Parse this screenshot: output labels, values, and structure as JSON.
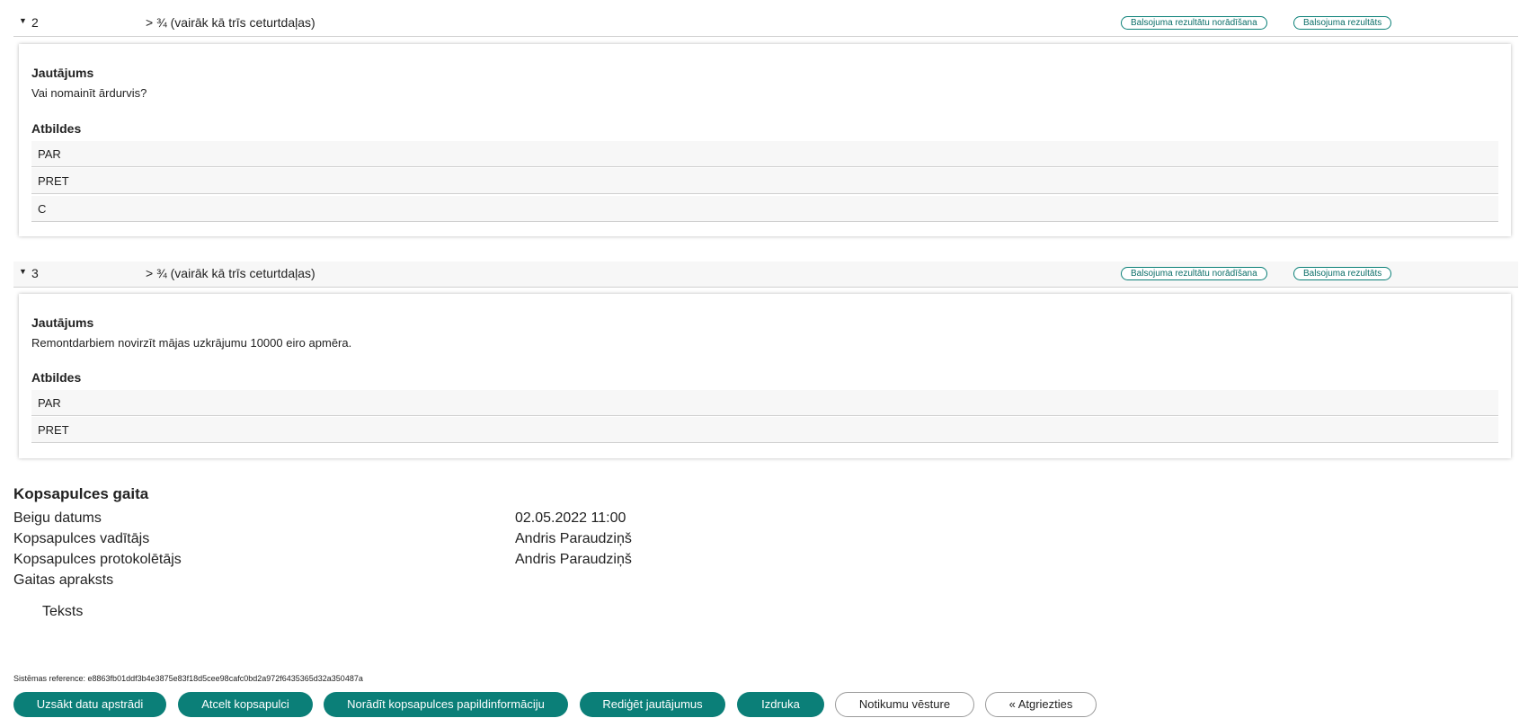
{
  "questions": [
    {
      "number": "2",
      "majority": "> ¾ (vairāk kā trīs ceturtdaļas)",
      "btn_indicate": "Balsojuma rezultātu norādīšana",
      "btn_result": "Balsojuma rezultāts",
      "question_label": "Jautājums",
      "question_text": "Vai nomainīt ārdurvis?",
      "answers_label": "Atbildes",
      "answers": [
        "PAR",
        "PRET",
        "C"
      ]
    },
    {
      "number": "3",
      "majority": "> ¾ (vairāk kā trīs ceturtdaļas)",
      "btn_indicate": "Balsojuma rezultātu norādīšana",
      "btn_result": "Balsojuma rezultāts",
      "question_label": "Jautājums",
      "question_text": "Remontdarbiem novirzīt mājas uzkrājumu 10000 eiro apmēra.",
      "answers_label": "Atbildes",
      "answers": [
        "PAR",
        "PRET"
      ]
    }
  ],
  "progress": {
    "title": "Kopsapulces gaita",
    "end_date_label": "Beigu datums",
    "end_date_value": "02.05.2022 11:00",
    "chair_label": "Kopsapulces vadītājs",
    "chair_value": "Andris Paraudziņš",
    "recorder_label": "Kopsapulces protokolētājs",
    "recorder_value": "Andris Paraudziņš",
    "description_label": "Gaitas apraksts",
    "description_text": "Teksts"
  },
  "system_reference": "Sistēmas reference: e8863fb01ddf3b4e3875e83f18d5cee98cafc0bd2a972f6435365d32a350487a",
  "actions": {
    "start_processing": "Uzsākt datu apstrādi",
    "cancel_meeting": "Atcelt kopsapulci",
    "add_info": "Norādīt kopsapulces papildinformāciju",
    "edit_questions": "Rediģēt jautājumus",
    "print": "Izdruka",
    "history": "Notikumu vēsture",
    "back": "« Atgriezties"
  },
  "colors": {
    "accent": "#0b7f78"
  },
  "icons": {
    "expand": "caret-down-icon"
  }
}
